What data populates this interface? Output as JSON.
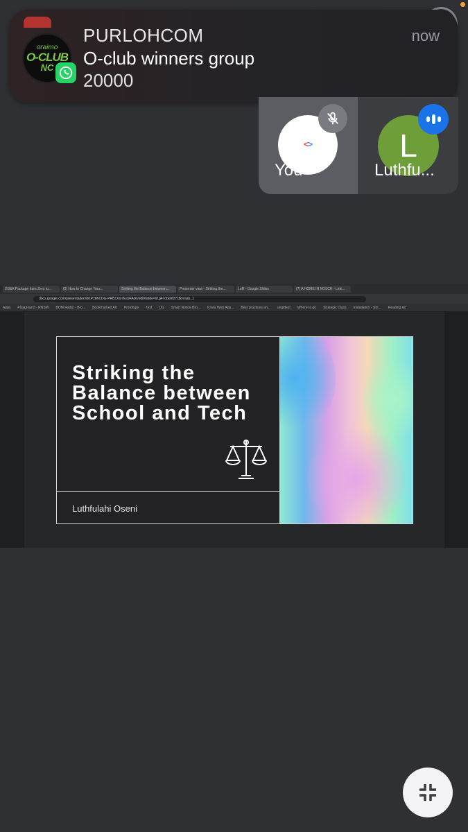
{
  "notification": {
    "app_name": "PURLOHCOM",
    "subtitle": "O-club winners group",
    "body": "20000",
    "time": "now",
    "avatar_line1": "oraimo",
    "avatar_line2": "O-CLUB",
    "avatar_line3": "NC",
    "accent": "#25d366"
  },
  "participants": {
    "self_label": "You",
    "other_label": "Luthfu...",
    "other_initial": "L",
    "other_avatar_color": "#6d9e3a",
    "speaking_color": "#1a73e8"
  },
  "shared_screen": {
    "tabs": [
      "DS&A Package from Zero to...",
      "(5) How to Change Your...",
      "Striking the Balance between...",
      "Presenter view - Striking the...",
      "Luffi - Google Slides",
      "(7) A HOME IN NOSCH - Link..."
    ],
    "url": "docs.google.com/presentation/d/1Pz8hCDG-PRB1Xsl7Es9FA0n/edit#slide=id.g47cbe0f27c8d7aa6_1",
    "bookmarks": [
      "Apps",
      "Playground - RNSW",
      "BOM Radar - Bro...",
      "Bookmarked Art",
      "Prototype",
      "Test",
      "UG",
      "Smart Notice Bro...",
      "Knew Web App...",
      "Best practices an...",
      "ungittest",
      "Where to go",
      "Strategic Class",
      "Installation - Stri...",
      "Reading list"
    ],
    "slide": {
      "title": "Striking the Balance between School and Tech",
      "author": "Luthfulahi Oseni"
    }
  }
}
